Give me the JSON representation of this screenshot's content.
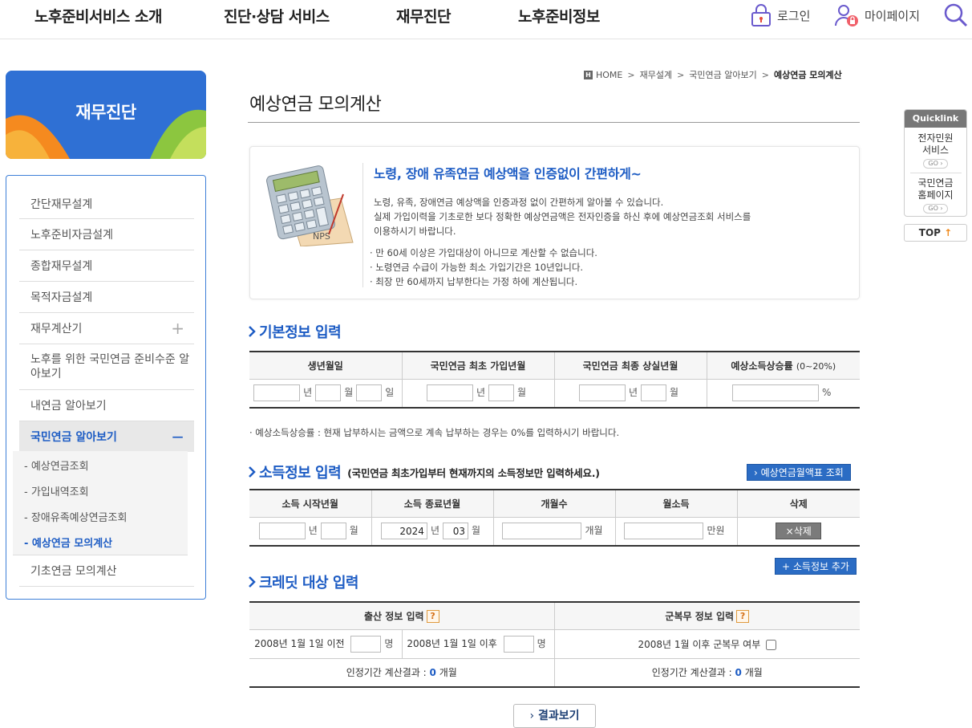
{
  "nav": {
    "menu": [
      "노후준비서비스 소개",
      "진단·상담 서비스",
      "재무진단",
      "노후준비정보"
    ],
    "login": "로그인",
    "mypage": "마이페이지"
  },
  "lnb": {
    "title": "재무진단",
    "items": [
      "간단재무설계",
      "노후준비자금설계",
      "종합재무설계",
      "목적자금설계",
      "재무계산기",
      "노후를 위한 국민연금 준비수준 알아보기",
      "내연금 알아보기",
      "국민연금 알아보기",
      "기초연금 모의계산"
    ],
    "plus": "+",
    "minus": "−",
    "sub": [
      "- 예상연금조회",
      "- 가입내역조회",
      "- 장애유족예상연금조회",
      "- 예상연금 모의계산"
    ]
  },
  "breadcrumb": {
    "home_badge": "H",
    "items": [
      "HOME",
      "재무설계",
      "국민연금 알아보기"
    ],
    "current": "예상연금 모의계산",
    "sep": ">"
  },
  "page_title": "예상연금 모의계산",
  "intro": {
    "calc_tag": "NPS",
    "headline": "노령, 장애 유족연금 예상액을 인증없이 간편하게~",
    "desc_lines": [
      "노령, 유족, 장애연금 예상액을 인증과정 없이 간편하게 알아볼 수 있습니다.",
      "실제 가입이력을 기초로한 보다 정확한 예상연금액은 전자인증을 하신 후에 예상연금조회 서비스를",
      "이용하시기 바랍니다."
    ],
    "bullets": [
      "· 만 60세 이상은 가입대상이 아니므로 계산할 수 없습니다.",
      "· 노령연금 수급이 가능한 최소 가입기간은 10년입니다.",
      "· 최장 만 60세까지 납부한다는 가정 하에 계산됩니다."
    ]
  },
  "basic": {
    "title": "기본정보 입력",
    "headers": [
      "생년월일",
      "국민연금 최초 가입년월",
      "국민연금 최종 상실년월",
      "예상소득상승률"
    ],
    "rate_range": "(0~20%)",
    "unit_year": "년",
    "unit_month": "월",
    "unit_day": "일",
    "unit_pct": "%",
    "note": "· 예상소득상승률 : 현재 납부하시는 금액으로 계속 납부하는 경우는 0%를 입력하시기 바랍니다."
  },
  "income": {
    "title": "소득정보 입력",
    "note": "(국민연금 최초가입부터 현재까지의 소득정보만 입력하세요.)",
    "lookup_button": "› 예상연금월액표 조회",
    "headers": [
      "소득 시작년월",
      "소득 종료년월",
      "개월수",
      "월소득",
      "삭제"
    ],
    "end_year": "2024",
    "end_month": "03",
    "unit_months": "개월",
    "unit_money": "만원",
    "delete_button": "×삭제",
    "add_button": "+ 소득정보 추가"
  },
  "credit": {
    "title": "크레딧 대상 입력",
    "birth_header": "출산 정보 입력",
    "military_header": "군복무 정보 입력",
    "help": "?",
    "before_label": "2008년 1월 1일 이전",
    "after_label": "2008년 1월 1일 이후",
    "person_unit": "명",
    "military_label": "2008년 1월 이후 군복무 여부",
    "result_label": "인정기간 계산결과 :",
    "birth_result": "0",
    "military_result": "0",
    "result_unit": "개월"
  },
  "result_button": "결과보기",
  "quicklink": {
    "title": "Quicklink",
    "items": [
      "전자민원 서비스",
      "국민연금 홈페이지"
    ],
    "go": "GO ›",
    "top": "TOP",
    "top_arrow": "↑"
  }
}
